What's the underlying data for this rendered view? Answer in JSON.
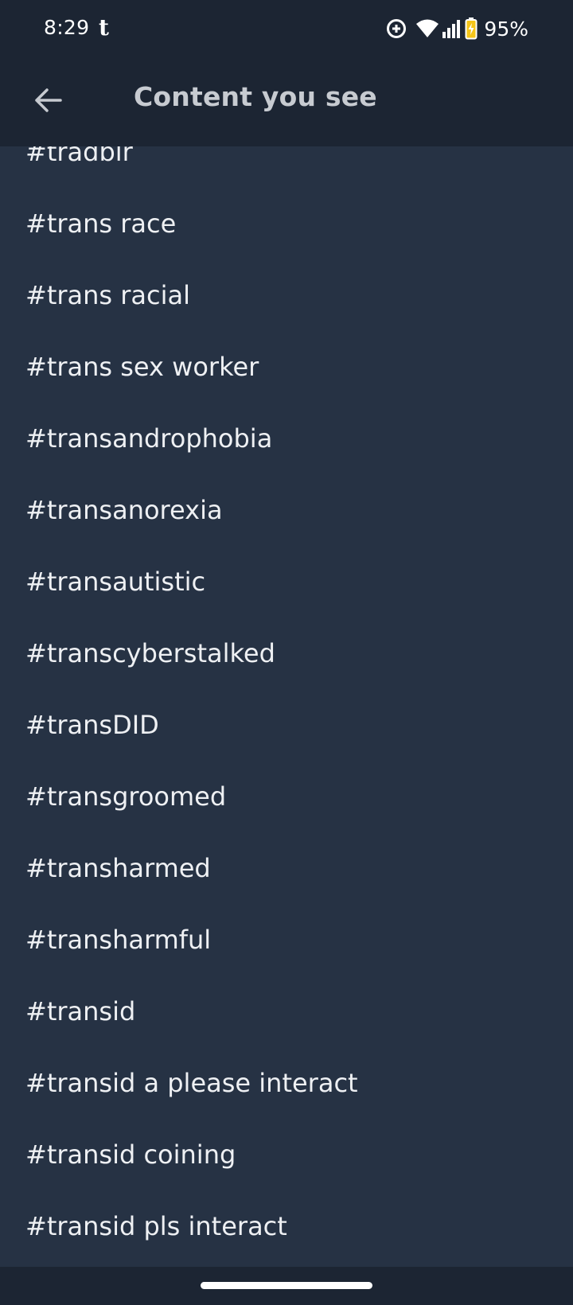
{
  "status_bar": {
    "time": "8:29",
    "app_icon": "t",
    "battery_percent": "95%",
    "icons": [
      "data-saver-icon",
      "wifi-icon",
      "signal-icon",
      "battery-charging-icon"
    ]
  },
  "header": {
    "back_icon": "arrow-left-icon",
    "title": "Content you see"
  },
  "tags": [
    "#tradblr",
    "#trans race",
    "#trans racial",
    "#trans sex worker",
    "#transandrophobia",
    "#transanorexia",
    "#transautistic",
    "#transcyberstalked",
    "#transDID",
    "#transgroomed",
    "#transharmed",
    "#transharmful",
    "#transid",
    "#transid a please interact",
    "#transid coining",
    "#transid pls interact"
  ],
  "colors": {
    "background": "#263244",
    "app_bar": "#1c2533",
    "text": "#eef0f3",
    "battery_accent": "#f5c518"
  }
}
